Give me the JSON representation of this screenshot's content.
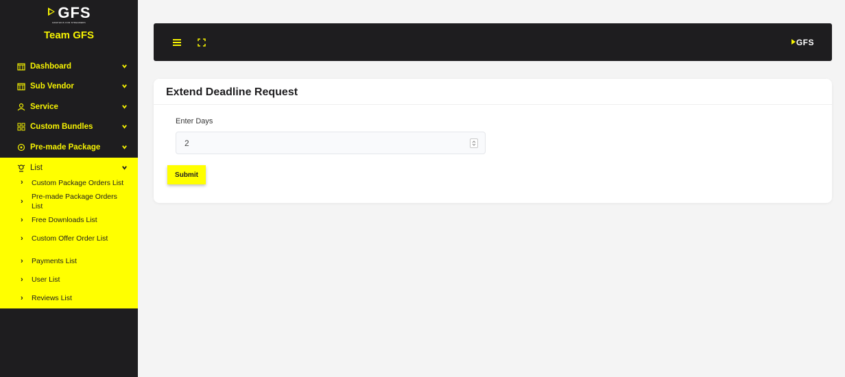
{
  "brand": {
    "logo_text": "GFS",
    "logo_tagline": "GRAPHICS FOR STREAMERS",
    "title": "Team GFS"
  },
  "sidebar": {
    "items": [
      {
        "label": "Dashboard",
        "icon": "store-icon"
      },
      {
        "label": "Sub Vendor",
        "icon": "store-icon"
      },
      {
        "label": "Service",
        "icon": "service-icon"
      },
      {
        "label": "Custom Bundles",
        "icon": "bundle-icon"
      },
      {
        "label": "Pre-made Package",
        "icon": "package-icon"
      }
    ],
    "open_item": {
      "label": "List",
      "icon": "list-icon",
      "sub_items": [
        "Custom Package Orders List",
        "Pre-made Package Orders List",
        "Free Downloads List",
        "Custom Offer Order List",
        "Payments List",
        "User List",
        "Reviews List"
      ]
    }
  },
  "topbar": {
    "logo_text": "GFS"
  },
  "main": {
    "card_title": "Extend Deadline Request",
    "field_label": "Enter Days",
    "field_value": "2",
    "submit_label": "Submit"
  },
  "colors": {
    "accent": "#ffff00",
    "dark": "#1e1d1f",
    "background": "#f4f4f4"
  }
}
